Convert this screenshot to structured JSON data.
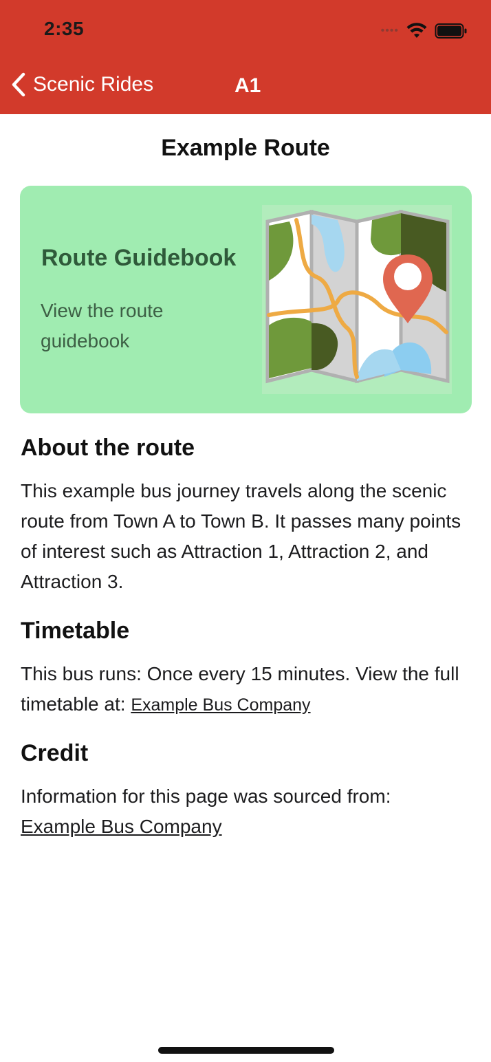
{
  "status_bar": {
    "time": "2:35"
  },
  "nav": {
    "back_label": "Scenic Rides",
    "title": "A1"
  },
  "page": {
    "title": "Example Route"
  },
  "guidebook_card": {
    "title": "Route Guidebook",
    "subtitle": "View the route guidebook"
  },
  "about": {
    "heading": "About the route",
    "text": "This example bus journey travels along the scenic route from Town A to Town B. It passes many points of interest such as Attraction 1, Attraction 2, and Attraction 3."
  },
  "timetable": {
    "heading": "Timetable",
    "text": "This bus runs: Once every 15 minutes. View the full timetable at:",
    "link_label": "Example Bus Company"
  },
  "credit": {
    "heading": "Credit",
    "text": "Information for this page was sourced from:",
    "link_label": "Example Bus Company"
  },
  "colors": {
    "header_red": "#d23a2b",
    "card_green": "#a0ecb1",
    "card_text": "#2f5a3a"
  },
  "icons": [
    "chevron-left-icon",
    "wifi-icon",
    "battery-icon",
    "map-icon"
  ]
}
